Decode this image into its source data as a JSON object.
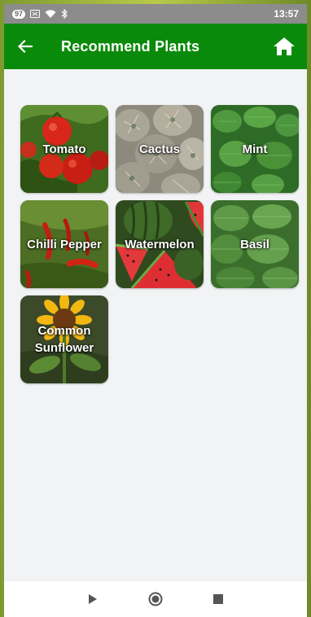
{
  "status_bar": {
    "battery": "97",
    "time": "13:57"
  },
  "app_bar": {
    "title": "Recommend Plants"
  },
  "plants": [
    {
      "label": "Tomato"
    },
    {
      "label": "Cactus"
    },
    {
      "label": "Mint"
    },
    {
      "label": "Chilli Pepper"
    },
    {
      "label": "Watermelon"
    },
    {
      "label": "Basil"
    },
    {
      "label": "Common Sunflower"
    }
  ],
  "colors": {
    "app_bar": "#0a8a0a",
    "status_bar": "#8c8c8c",
    "background": "#f2f3f4"
  },
  "icons": {
    "back": "arrow-left-icon",
    "home": "home-icon",
    "nav_back": "triangle-play-icon",
    "nav_home": "circle-icon",
    "nav_recent": "square-icon"
  }
}
